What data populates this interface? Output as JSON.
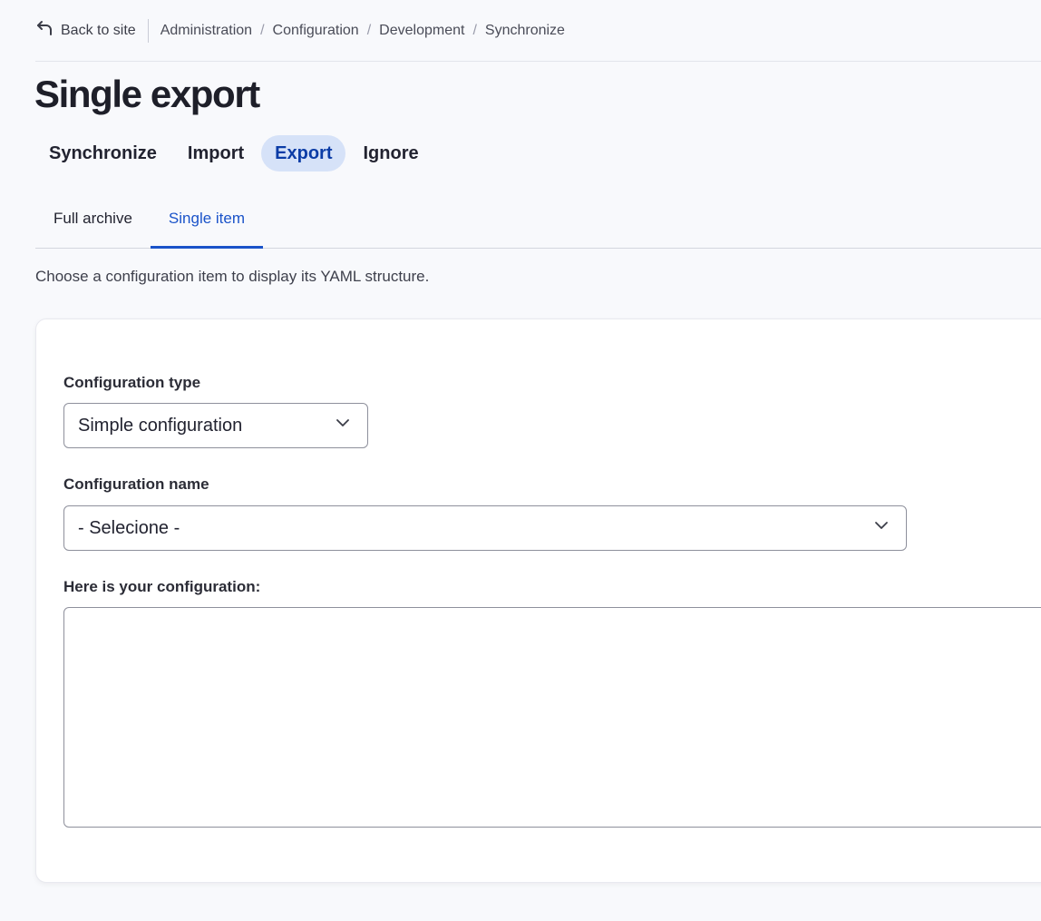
{
  "topbar": {
    "back_label": "Back to site",
    "breadcrumb": [
      "Administration",
      "Configuration",
      "Development",
      "Synchronize"
    ]
  },
  "page": {
    "title": "Single export",
    "primary_tabs": [
      "Synchronize",
      "Import",
      "Export",
      "Ignore"
    ],
    "secondary_tabs": [
      "Full archive",
      "Single item"
    ],
    "description": "Choose a configuration item to display its YAML structure."
  },
  "form": {
    "config_type_label": "Configuration type",
    "config_type_value": "Simple configuration",
    "config_name_label": "Configuration name",
    "config_name_value": "- Selecione -",
    "output_label": "Here is your configuration:",
    "output_value": ""
  }
}
